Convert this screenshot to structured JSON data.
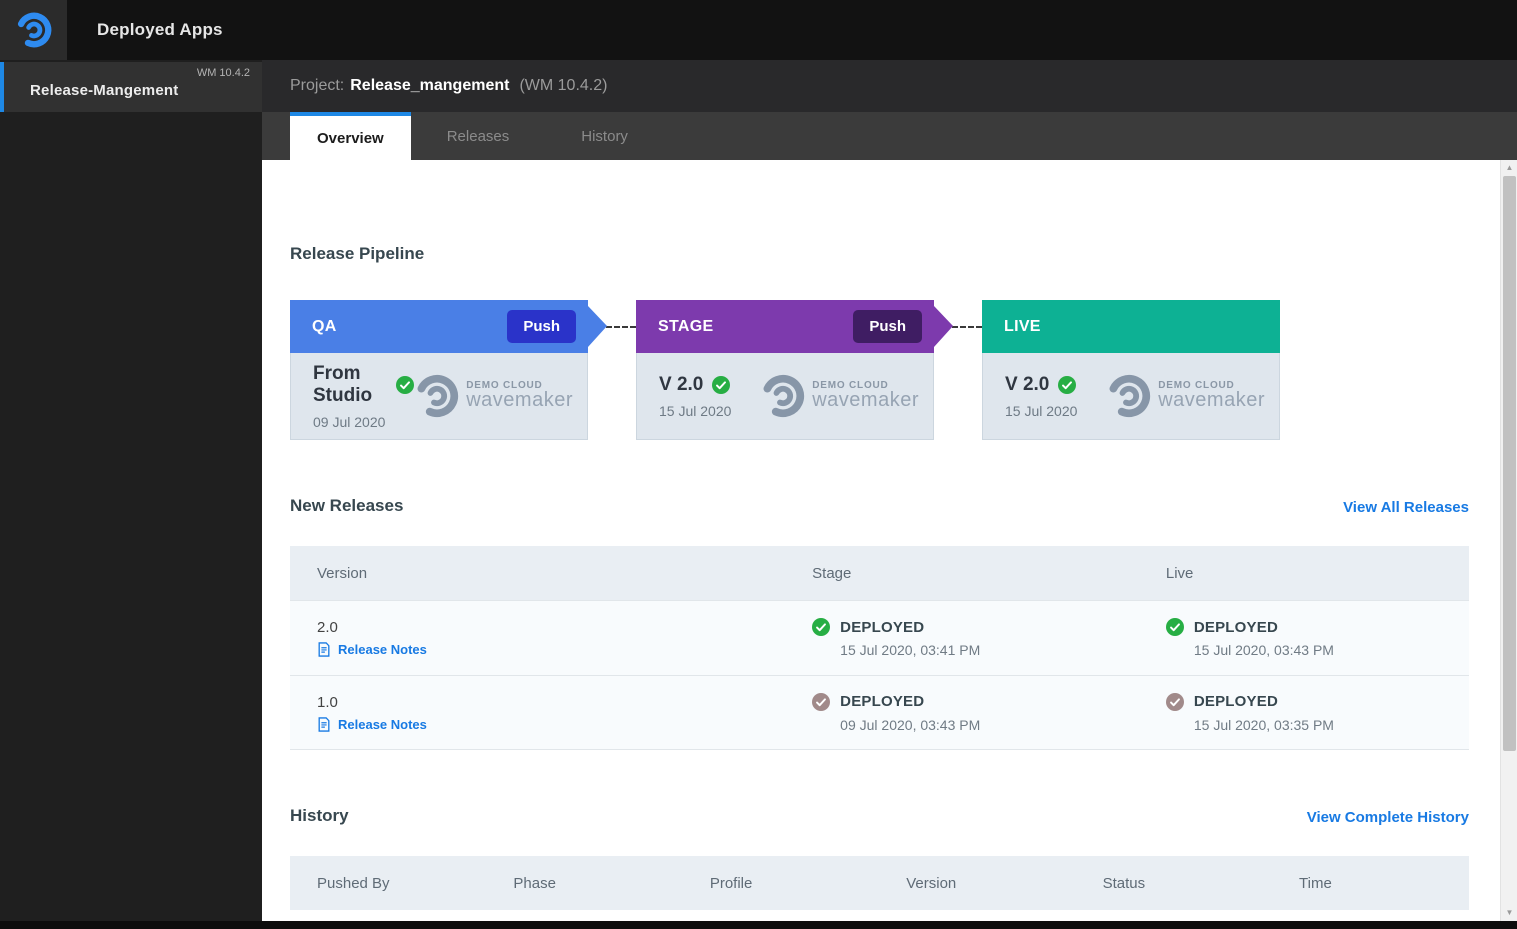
{
  "topbar": {
    "title": "Deployed Apps",
    "logo": "wavemaker-wave-icon"
  },
  "sidebar": {
    "active_item": {
      "name": "Release-Mangement",
      "version": "WM 10.4.2"
    }
  },
  "project_header": {
    "label": "Project:",
    "name": "Release_mangement",
    "version": "(WM 10.4.2)"
  },
  "tabs": [
    {
      "label": "Overview",
      "active": true
    },
    {
      "label": "Releases",
      "active": false
    },
    {
      "label": "History",
      "active": false
    }
  ],
  "pipeline": {
    "title": "Release Pipeline",
    "stages": [
      {
        "name": "QA",
        "push_label": "Push",
        "version": "From Studio",
        "date": "09 Jul 2020",
        "header_color": "#4a7fe6",
        "push_color": "#2a33c9",
        "status_icon_color": "#27ae44"
      },
      {
        "name": "STAGE",
        "push_label": "Push",
        "version": "V 2.0",
        "date": "15 Jul 2020",
        "header_color": "#7d3aad",
        "push_color": "#3f1d63",
        "status_icon_color": "#27ae44"
      },
      {
        "name": "LIVE",
        "version": "V 2.0",
        "date": "15 Jul 2020",
        "header_color": "#0db194",
        "status_icon_color": "#27ae44"
      }
    ],
    "cloud_logo": {
      "line1": "DEMO CLOUD",
      "line2": "wavemaker"
    }
  },
  "new_releases": {
    "title": "New Releases",
    "link_label": "View All Releases",
    "columns": [
      "Version",
      "Stage",
      "Live"
    ],
    "rows": [
      {
        "version": "2.0",
        "notes_label": "Release Notes",
        "stage": {
          "status": "DEPLOYED",
          "time": "15 Jul 2020, 03:41 PM",
          "icon_color": "#27ae44"
        },
        "live": {
          "status": "DEPLOYED",
          "time": "15 Jul 2020, 03:43 PM",
          "icon_color": "#27ae44"
        }
      },
      {
        "version": "1.0",
        "notes_label": "Release Notes",
        "stage": {
          "status": "DEPLOYED",
          "time": "09 Jul 2020, 03:43 PM",
          "icon_color": "#a18a8a"
        },
        "live": {
          "status": "DEPLOYED",
          "time": "15 Jul 2020, 03:35 PM",
          "icon_color": "#a18a8a"
        }
      }
    ]
  },
  "history": {
    "title": "History",
    "link_label": "View Complete History",
    "columns": [
      "Pushed By",
      "Phase",
      "Profile",
      "Version",
      "Status",
      "Time"
    ]
  },
  "colors": {
    "accent_blue": "#1e88e5",
    "link_blue": "#187ae3",
    "qa_header": "#4a7fe6",
    "qa_push": "#2a33c9",
    "stage_header": "#7d3aad",
    "stage_push": "#3f1d63",
    "live_header": "#0db194",
    "card_body": "#dfe6ed",
    "green_check": "#27ae44",
    "muted_check": "#a18a8a",
    "table_header_bg": "#e9eef3",
    "row_bg": "#f8fbfd"
  }
}
